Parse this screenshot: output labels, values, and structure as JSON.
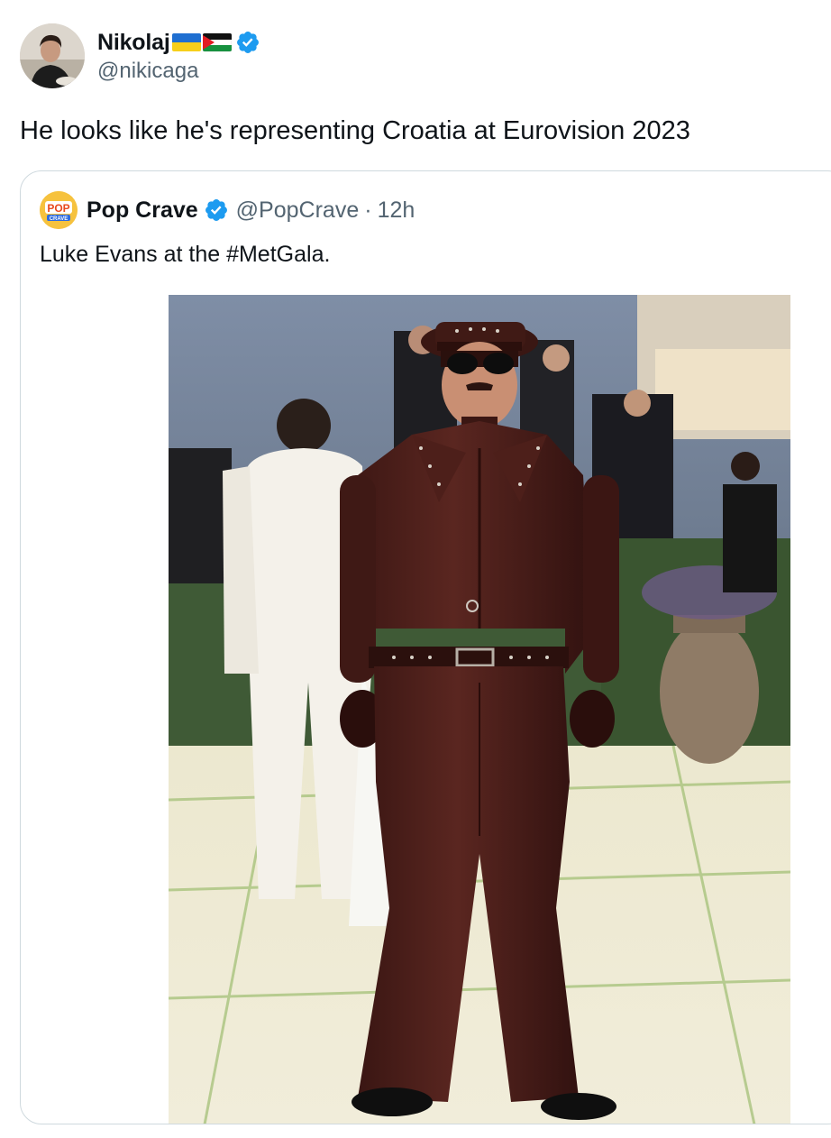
{
  "tweet": {
    "author": {
      "display_name": "Nikolaj",
      "flags": [
        "ukraine-flag",
        "palestine-flag"
      ],
      "verified": true,
      "handle": "@nikicaga"
    },
    "text": "He looks like he's representing Croatia at Eurovision 2023"
  },
  "quoted_tweet": {
    "author": {
      "display_name": "Pop Crave",
      "avatar_text": "POP",
      "avatar_subtext": "CRAVE",
      "verified": true,
      "handle": "@PopCrave",
      "separator": "·",
      "time": "12h"
    },
    "text": "Luke Evans at the #MetGala.",
    "media": {
      "icon": "photo"
    }
  },
  "colors": {
    "verified_blue": "#1d9bf0",
    "secondary_text": "#536471",
    "border": "#cfd9de",
    "leather_brown": "#4a1f1a"
  }
}
